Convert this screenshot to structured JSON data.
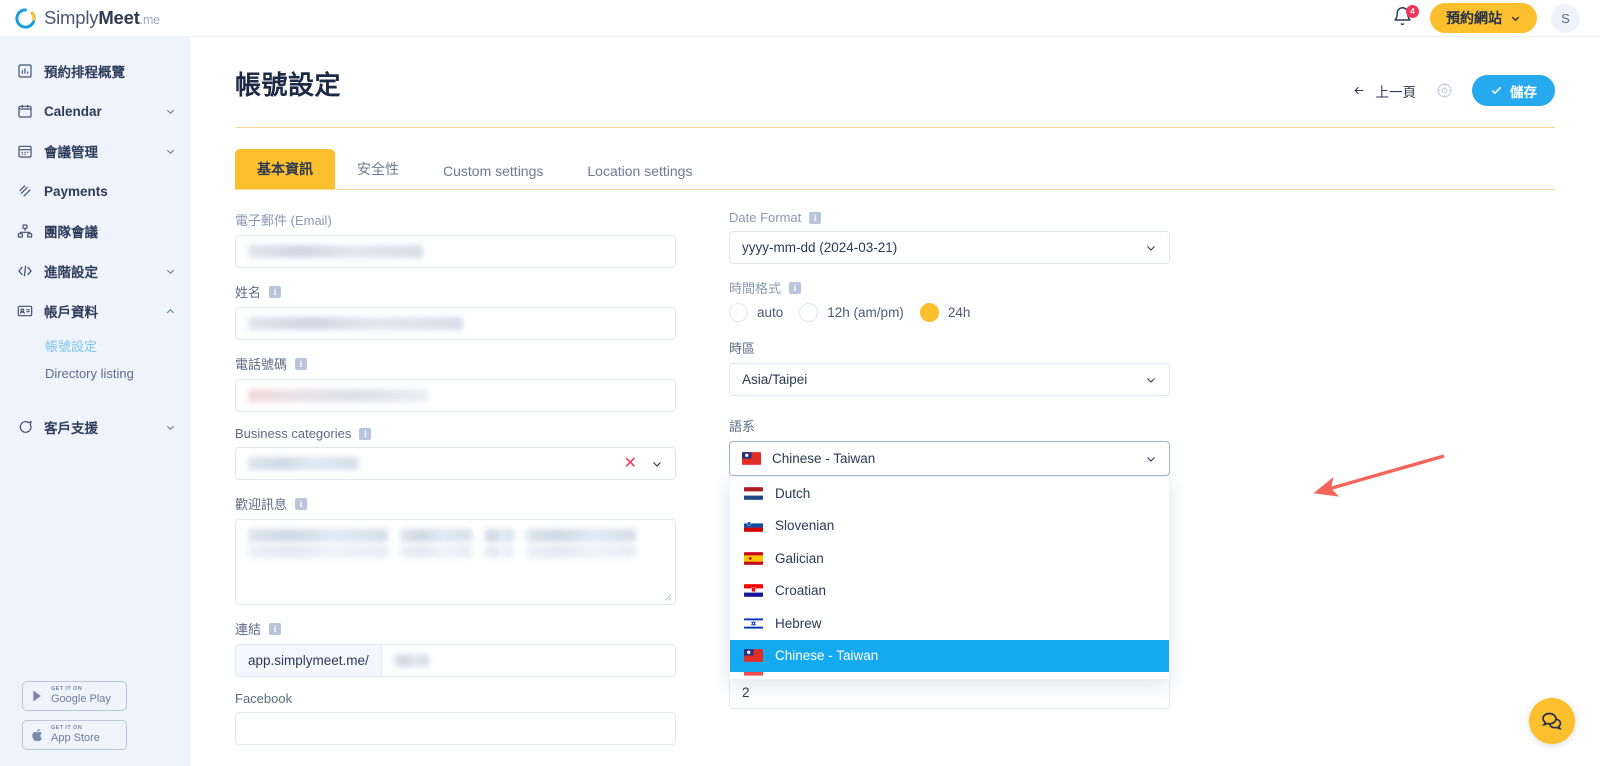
{
  "brand": {
    "name_bold": "Meet",
    "name_light": "Simply",
    "suffix": ".me",
    "logo_icon": "simplymeet-logo-icon"
  },
  "topbar": {
    "notification_icon": "bell-icon",
    "notification_count": "4",
    "booking_site_button": "預約網站",
    "booking_site_chevron_icon": "chevron-down-icon",
    "avatar_initial": "S"
  },
  "sidebar": {
    "items": [
      {
        "label": "預約排程概覽",
        "icon": "chart-bar-icon",
        "expandable": false
      },
      {
        "label": "Calendar",
        "icon": "calendar-icon",
        "expandable": true
      },
      {
        "label": "會議管理",
        "icon": "meeting-calendar-icon",
        "expandable": true
      },
      {
        "label": "Payments",
        "icon": "payments-icon",
        "expandable": false
      },
      {
        "label": "團隊會議",
        "icon": "team-hierarchy-icon",
        "expandable": false
      },
      {
        "label": "進階設定",
        "icon": "code-brackets-icon",
        "expandable": true
      },
      {
        "label": "帳戶資料",
        "icon": "id-card-icon",
        "expandable": true,
        "expanded": true
      },
      {
        "label": "客戶支援",
        "icon": "chat-support-icon",
        "expandable": true
      }
    ],
    "sub_items": [
      {
        "label": "帳號設定",
        "active": true
      },
      {
        "label": "Directory listing",
        "active": false
      }
    ],
    "store_badges": [
      {
        "top": "GET IT ON",
        "name": "Google Play",
        "icon": "google-play-icon"
      },
      {
        "top": "GET IT ON",
        "name": "App Store",
        "icon": "apple-icon"
      }
    ]
  },
  "page": {
    "title": "帳號設定",
    "back_label": "上一頁",
    "back_icon": "arrow-left-icon",
    "settings_icon": "gear-icon",
    "save_label": "儲存",
    "save_check_icon": "check-icon"
  },
  "tabs": [
    {
      "label": "基本資訊",
      "active": true
    },
    {
      "label": "安全性",
      "active": false
    },
    {
      "label": "Custom settings",
      "active": false
    },
    {
      "label": "Location settings",
      "active": false
    }
  ],
  "left_column": {
    "email": {
      "label": "電子郵件 (Email)",
      "value": "",
      "redacted": true
    },
    "name": {
      "label": "姓名",
      "info_icon": "info-icon",
      "value": "",
      "redacted": true
    },
    "phone": {
      "label": "電話號碼",
      "info_icon": "info-icon",
      "value": "",
      "redacted": true
    },
    "business_categories": {
      "label": "Business categories",
      "info_icon": "info-icon",
      "value": "",
      "redacted": true,
      "clear_icon": "close-x-icon",
      "chevron_icon": "chevron-down-icon"
    },
    "welcome_message": {
      "label": "歡迎訊息",
      "info_icon": "info-icon",
      "value": "",
      "redacted": true,
      "resize_icon": "resize-grip-icon"
    },
    "link": {
      "label": "連結",
      "info_icon": "info-icon",
      "prefix": "app.simplymeet.me/",
      "value": "",
      "redacted": true
    },
    "facebook": {
      "label": "Facebook",
      "value": ""
    }
  },
  "right_column": {
    "date_format": {
      "label": "Date Format",
      "info_icon": "info-icon",
      "value": "yyyy-mm-dd (2024-03-21)",
      "chevron_icon": "chevron-down-icon"
    },
    "time_format": {
      "label": "時間格式",
      "info_icon": "info-icon",
      "options": [
        {
          "label": "auto",
          "selected": false
        },
        {
          "label": "12h (am/pm)",
          "selected": false
        },
        {
          "label": "24h",
          "selected": true
        }
      ]
    },
    "timezone": {
      "label": "時區",
      "value": "Asia/Taipei",
      "chevron_icon": "chevron-down-icon"
    },
    "language": {
      "label": "語系",
      "value": "Chinese - Taiwan",
      "flag": "tw",
      "chevron_icon": "chevron-down-icon",
      "open": true,
      "options": [
        {
          "label": "Dutch",
          "flag": "nl",
          "selected": false
        },
        {
          "label": "Slovenian",
          "flag": "si",
          "selected": false
        },
        {
          "label": "Galician",
          "flag": "es",
          "selected": false
        },
        {
          "label": "Croatian",
          "flag": "hr",
          "selected": false
        },
        {
          "label": "Hebrew",
          "flag": "il",
          "selected": false
        },
        {
          "label": "Chinese - Taiwan",
          "flag": "tw",
          "selected": true
        },
        {
          "label": "",
          "flag": "partial",
          "selected": false
        }
      ]
    },
    "number_field": {
      "value": "2"
    }
  },
  "annotation": {
    "type": "arrow",
    "color": "#f4655c",
    "points_to": "language-select"
  },
  "chat_widget": {
    "icon": "chat-bubbles-icon",
    "color": "#fcbf2e"
  },
  "colors": {
    "accent_yellow": "#fcbf2e",
    "accent_blue": "#27a9f0",
    "highlight_blue": "#15aaf0",
    "sidebar_bg": "#eff4fc",
    "badge_red": "#f5365c",
    "annotation_red": "#f4655c"
  }
}
